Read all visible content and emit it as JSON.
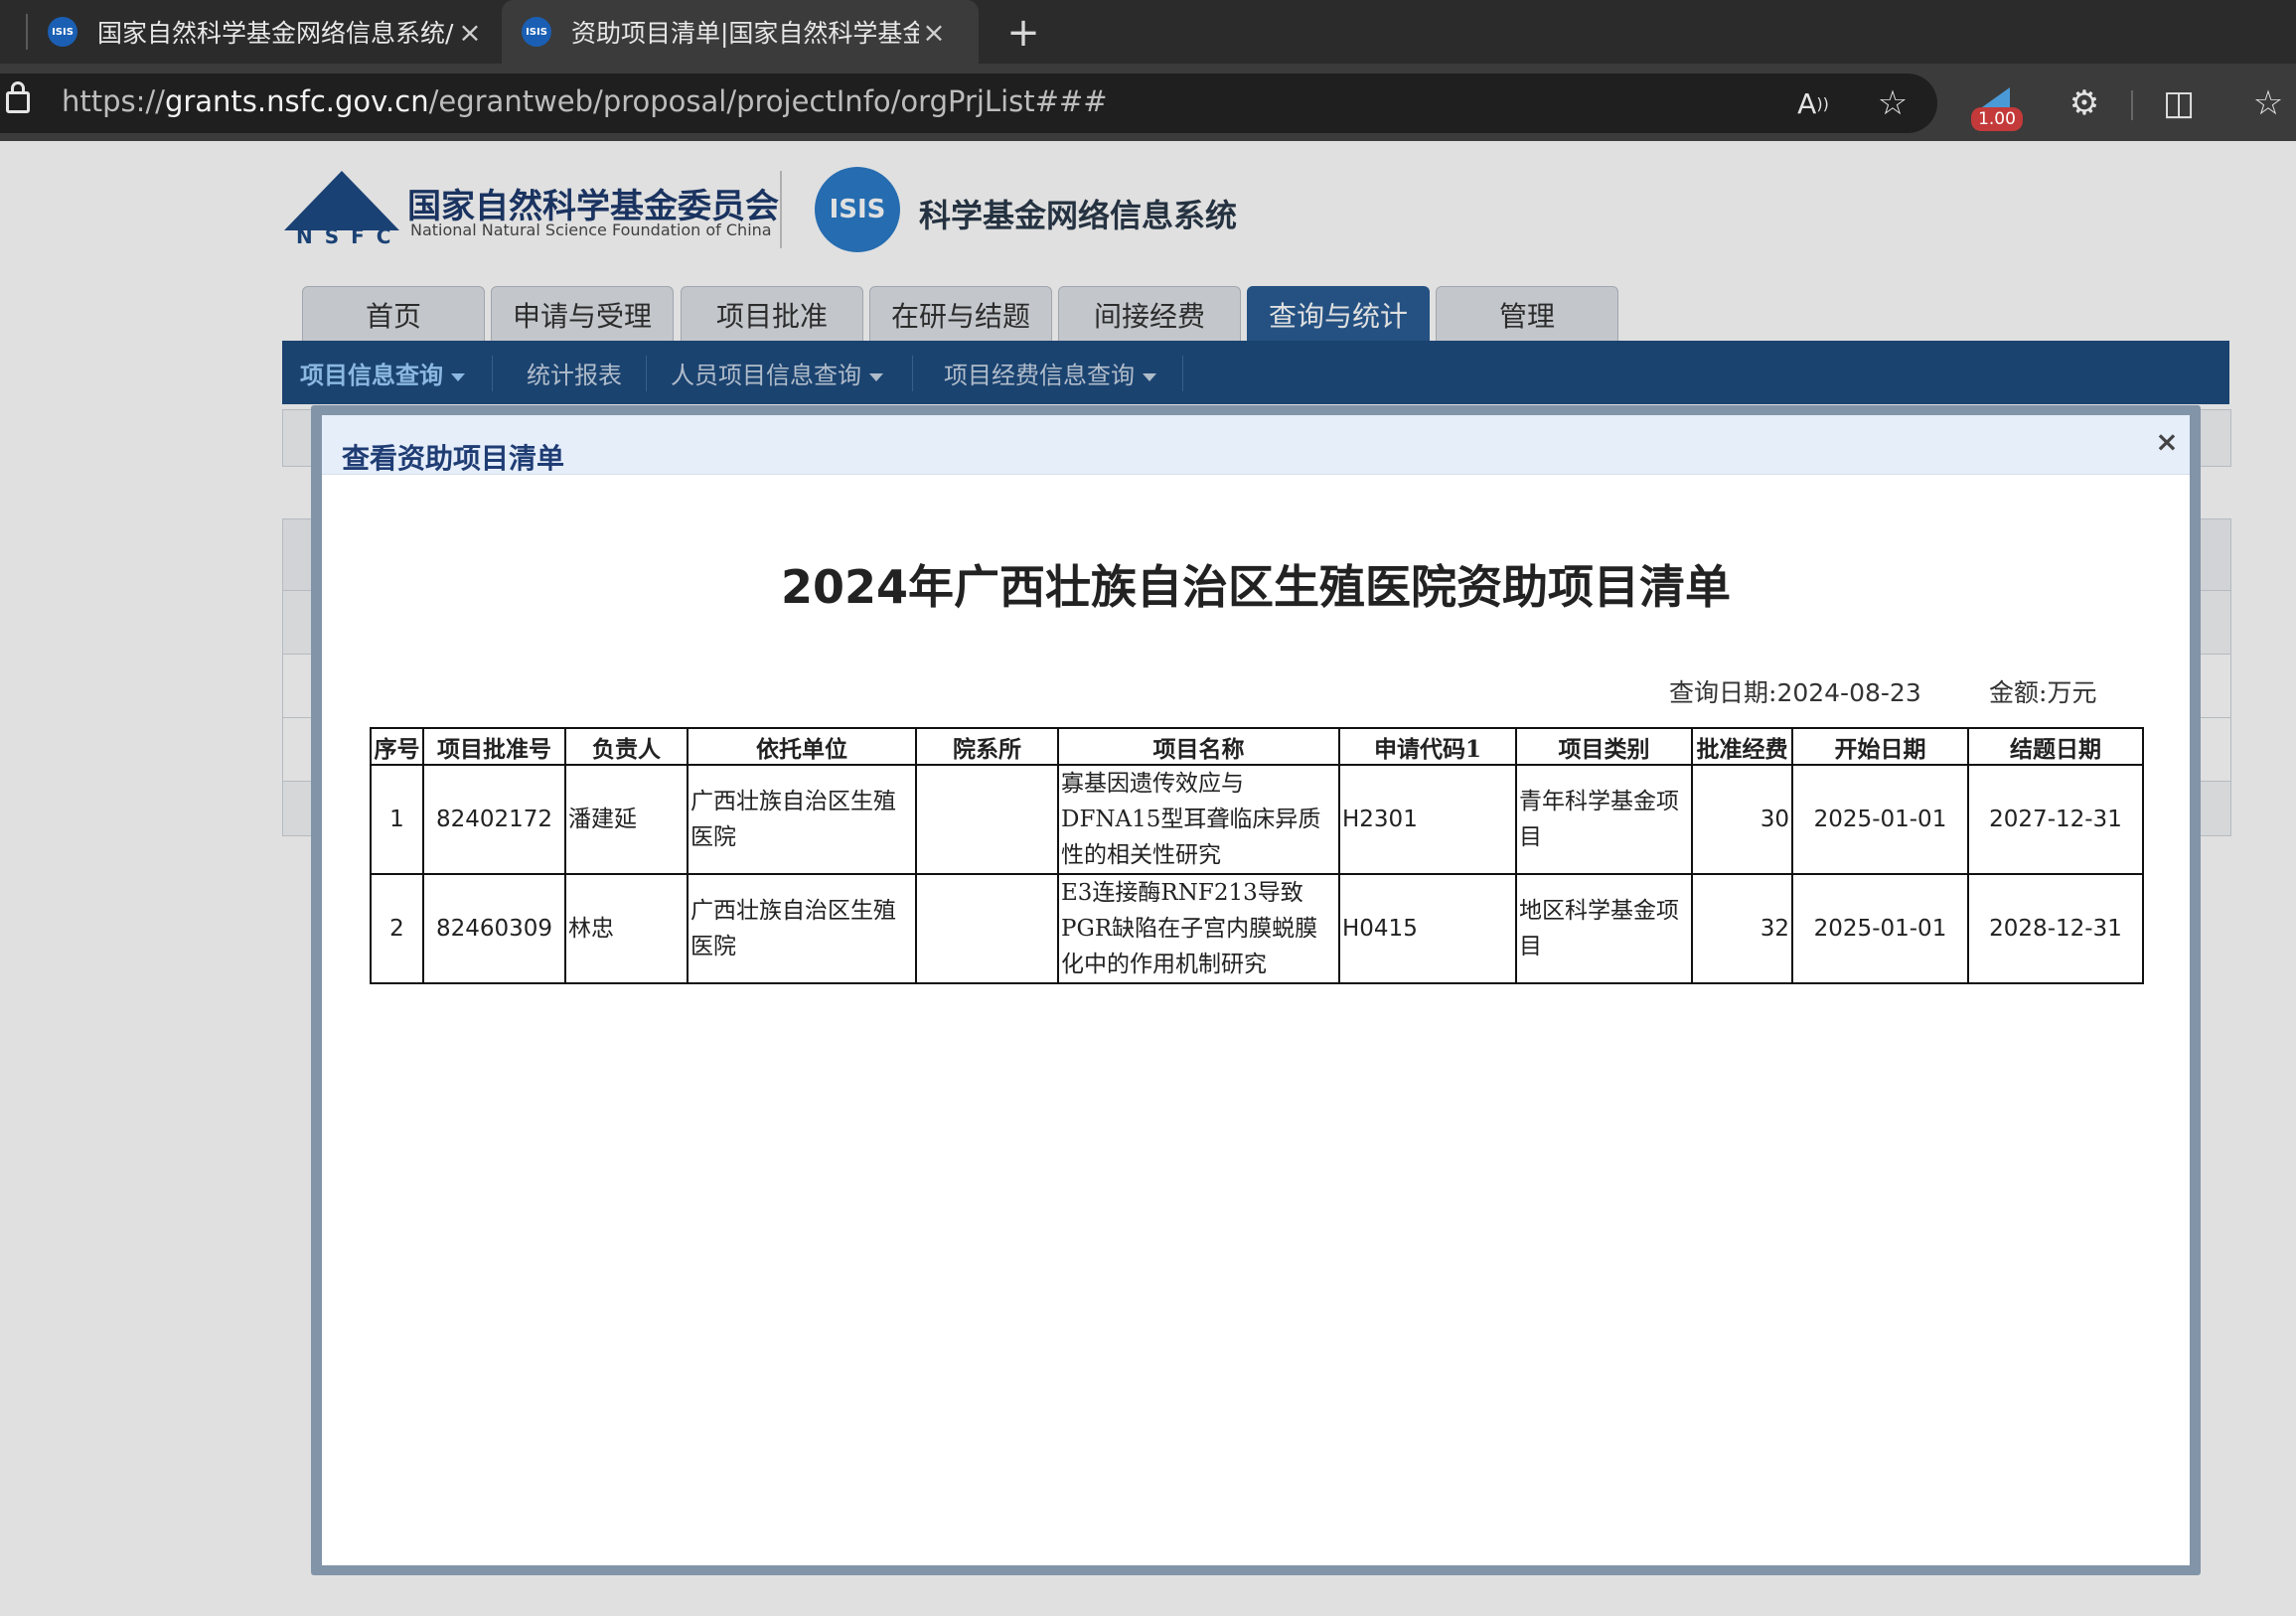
{
  "browser": {
    "tabs": [
      {
        "favicon": "ISIS",
        "title": "国家自然科学基金网络信息系统/"
      },
      {
        "favicon": "ISIS",
        "title": "资助项目清单|国家自然科学基金"
      }
    ],
    "new_tab": "+",
    "url_prefix": "https://",
    "url_host": "grants.nsfc.gov.cn",
    "url_path": "/egrantweb/proposal/projectInfo/orgPrjList###",
    "zoom_badge": "1.00",
    "icons": [
      "read-aloud-icon",
      "favorite-star-icon",
      "extensions-icon",
      "split-screen-icon",
      "favorites-icon"
    ]
  },
  "site": {
    "nsfc_letters": "NSFC",
    "org_name": "国家自然科学基金委员会",
    "org_name_en": "National Natural Science Foundation of China",
    "isis_badge": "ISIS",
    "system_name": "科学基金网络信息系统",
    "nav_tabs": [
      "首页",
      "申请与受理",
      "项目批准",
      "在研与结题",
      "间接经费",
      "查询与统计",
      "管理"
    ],
    "active_nav": "查询与统计",
    "subnav": [
      "项目信息查询",
      "统计报表",
      "人员项目信息查询",
      "项目经费信息查询"
    ]
  },
  "modal": {
    "title": "查看资助项目清单",
    "close": "×",
    "report_title_year": "2024",
    "report_title_rest": "年广西壮族自治区生殖医院资助项目清单",
    "query_date_label": "查询日期:",
    "query_date": "2024-08-23",
    "amount_label": "金额:",
    "amount_unit": "万元",
    "columns": [
      "序号",
      "项目批准号",
      "负责人",
      "依托单位",
      "院系所",
      "项目名称",
      "申请代码1",
      "项目类别",
      "批准经费",
      "开始日期",
      "结题日期"
    ],
    "rows": [
      {
        "no": "1",
        "approval_no": "82402172",
        "pi": "潘建延",
        "institution": "广西壮族自治区生殖医院",
        "department": "",
        "name": "寡基因遗传效应与DFNA15型耳聋临床异质性的相关性研究",
        "code": "H2301",
        "category": "青年科学基金项目",
        "funding": "30",
        "start": "2025-01-01",
        "end": "2027-12-31"
      },
      {
        "no": "2",
        "approval_no": "82460309",
        "pi": "林忠",
        "institution": "广西壮族自治区生殖医院",
        "department": "",
        "name": "E3连接酶RNF213导致PGR缺陷在子宫内膜蜕膜化中的作用机制研究",
        "code": "H0415",
        "category": "地区科学基金项目",
        "funding": "32",
        "start": "2025-01-01",
        "end": "2028-12-31"
      }
    ]
  }
}
